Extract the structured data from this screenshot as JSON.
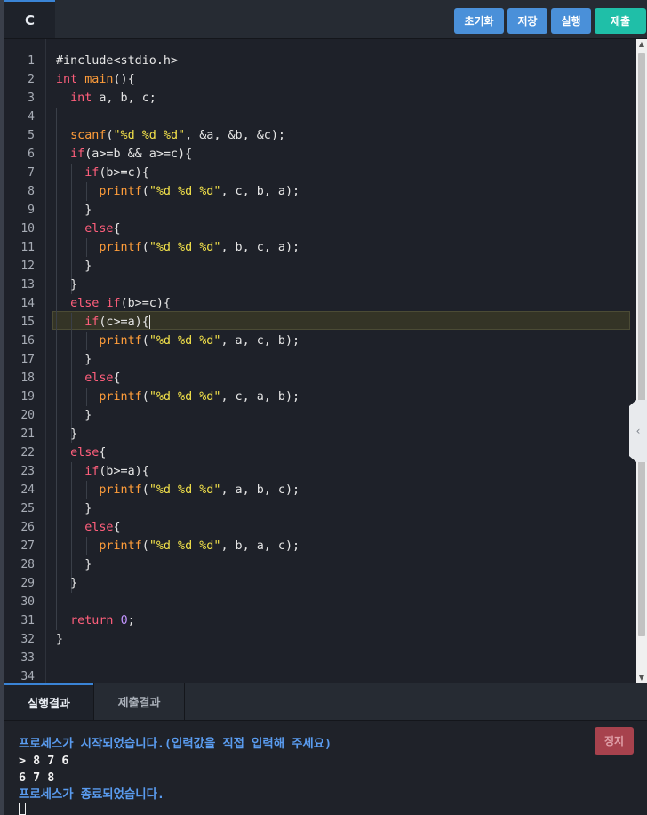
{
  "header": {
    "language_tab": "C",
    "buttons": {
      "reset": "초기화",
      "save": "저장",
      "run": "실행",
      "submit": "제출"
    }
  },
  "editor": {
    "line_numbers": [
      "1",
      "2",
      "3",
      "4",
      "5",
      "6",
      "7",
      "8",
      "9",
      "10",
      "11",
      "12",
      "13",
      "14",
      "15",
      "16",
      "17",
      "18",
      "19",
      "20",
      "21",
      "22",
      "23",
      "24",
      "25",
      "26",
      "27",
      "28",
      "29",
      "30",
      "31",
      "32",
      "33",
      "34"
    ],
    "active_line": 15,
    "code_lines": [
      "#include<stdio.h>",
      "int main(){",
      "  int a, b, c;",
      "",
      "  scanf(\"%d %d %d\", &a, &b, &c);",
      "  if(a>=b && a>=c){",
      "    if(b>=c){",
      "      printf(\"%d %d %d\", c, b, a);",
      "    }",
      "    else{",
      "      printf(\"%d %d %d\", b, c, a);",
      "    }",
      "  }",
      "  else if(b>=c){",
      "    if(c>=a){",
      "      printf(\"%d %d %d\", a, c, b);",
      "    }",
      "    else{",
      "      printf(\"%d %d %d\", c, a, b);",
      "    }",
      "  }",
      "  else{",
      "    if(b>=a){",
      "      printf(\"%d %d %d\", a, b, c);",
      "    }",
      "    else{",
      "      printf(\"%d %d %d\", b, a, c);",
      "    }",
      "  }",
      "",
      "  return 0;",
      "}",
      "",
      ""
    ]
  },
  "bottom_tabs": {
    "run_result": "실행결과",
    "submit_result": "제출결과"
  },
  "console": {
    "lines": [
      {
        "text": "프로세스가 시작되었습니다.(입력값을 직접 입력해 주세요)",
        "color": "#5a9cf0"
      },
      {
        "text": "> 8 7 6",
        "color": "#f2f2f2"
      },
      {
        "text": "6 7 8",
        "color": "#f2f2f2"
      },
      {
        "text": "프로세스가 종료되었습니다.",
        "color": "#5a9cf0"
      }
    ],
    "stop_button": "정지"
  },
  "colors": {
    "accent": "#4a90d9",
    "submit": "#1fbfa8",
    "stop": "#a7424d",
    "keyword": "#ff5f7c",
    "function": "#ff9d3a",
    "string": "#f2e14a",
    "number": "#c294ff"
  },
  "icons": {
    "side_handle": "chevron-left-icon",
    "scroll_up": "arrow-up-icon",
    "scroll_down": "arrow-down-icon"
  }
}
